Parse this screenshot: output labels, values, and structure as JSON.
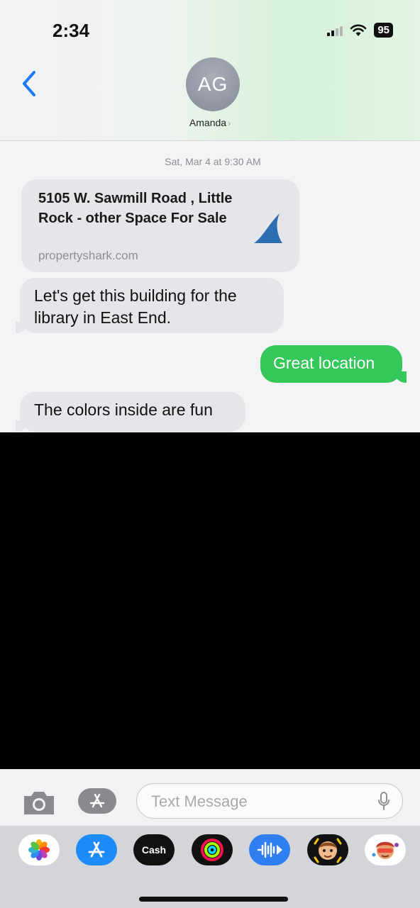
{
  "status_bar": {
    "time": "2:34",
    "battery": "95"
  },
  "header": {
    "avatar_initials": "AG",
    "contact_name": "Amanda"
  },
  "conversation": {
    "timestamp": "Sat, Mar 4 at 9:30 AM",
    "link_preview": {
      "title": "5105 W. Sawmill Road , Little Rock - other Space For Sale",
      "domain": "propertyshark.com"
    },
    "messages": [
      {
        "direction": "incoming",
        "text": "Let's get this building for the library in East End."
      },
      {
        "direction": "outgoing",
        "text": "Great location"
      },
      {
        "direction": "incoming",
        "text": "The colors inside are fun"
      }
    ]
  },
  "composer": {
    "placeholder": "Text Message"
  },
  "app_drawer": {
    "apps": [
      {
        "name": "photos-app-icon"
      },
      {
        "name": "app-store-icon"
      },
      {
        "name": "cash-app-icon",
        "label": "Cash"
      },
      {
        "name": "fitness-activity-icon"
      },
      {
        "name": "audio-message-icon"
      },
      {
        "name": "memoji-icon"
      },
      {
        "name": "memoji-stickers-icon"
      }
    ]
  },
  "colors": {
    "accent_blue": "#1a7cf4",
    "outgoing_bubble": "#34c759",
    "incoming_bubble": "#e6e6ea"
  }
}
